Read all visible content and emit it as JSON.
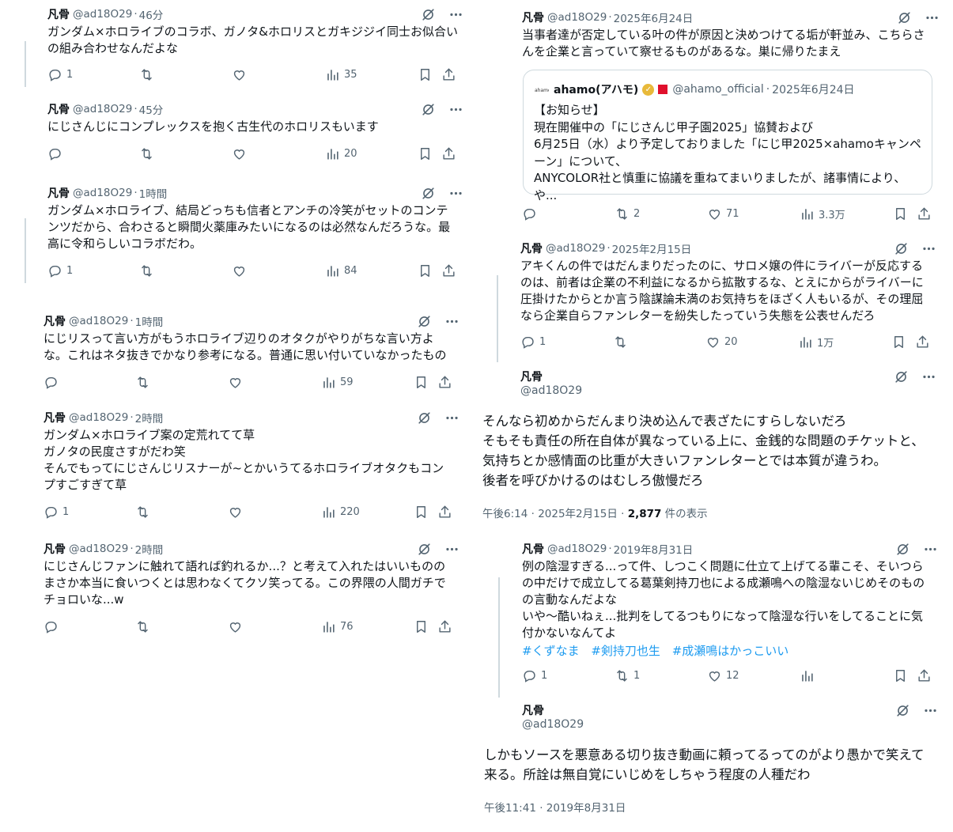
{
  "left_tweets": [
    {
      "name": "凡骨",
      "handle": "@ad18O29",
      "time": "46分",
      "text": "ガンダム×ホロライブのコラボ、ガノタ&ホロリスとガキジジイ同士お似合いの組み合わせなんだよな",
      "replies": "1",
      "retweets": "",
      "likes": "",
      "views": "35"
    },
    {
      "name": "凡骨",
      "handle": "@ad18O29",
      "time": "45分",
      "text": "にじさんじにコンプレックスを抱く古生代のホロリスもいます",
      "replies": "",
      "retweets": "",
      "likes": "",
      "views": "20"
    },
    {
      "name": "凡骨",
      "handle": "@ad18O29",
      "time": "1時間",
      "text": "ガンダム×ホロライブ、結局どっちも信者とアンチの冷笑がセットのコンテンツだから、合わさると瞬間火薬庫みたいになるのは必然なんだろうな。最高に令和らしいコラボだわ。",
      "replies": "1",
      "retweets": "",
      "likes": "",
      "views": "84"
    },
    {
      "name": "凡骨",
      "handle": "@ad18O29",
      "time": "1時間",
      "text": "にじリスって言い方がもうホロライブ辺りのオタクがやりがちな言い方よな。これはネタ抜きでかなり参考になる。普通に思い付いていなかったもの",
      "replies": "",
      "retweets": "",
      "likes": "",
      "views": "59"
    },
    {
      "name": "凡骨",
      "handle": "@ad18O29",
      "time": "2時間",
      "text": "ガンダム×ホロライブ案の定荒れてて草\nガノタの民度さすがだわ笑\nそんでもってにじさんじリスナーが~とかいうてるホロライブオタクもコンプすごすぎて草",
      "replies": "1",
      "retweets": "",
      "likes": "",
      "views": "220"
    },
    {
      "name": "凡骨",
      "handle": "@ad18O29",
      "time": "2時間",
      "text": "にじさんじファンに触れて語れば釣れるか...？と考えて入れたはいいもののまさか本当に食いつくとは思わなくてクソ笑ってる。この界隈の人間ガチでチョロいな...w",
      "replies": "",
      "retweets": "",
      "likes": "",
      "views": "76"
    }
  ],
  "right_tweet1": {
    "name": "凡骨",
    "handle": "@ad18O29",
    "time": "2025年6月24日",
    "text": "当事者達が否定している叶の件が原因と決めつけてる垢が軒並み、こちらさんを企業と言っていて察せるものがあるな。巣に帰りたまえ",
    "quote": {
      "logo": "ahamo",
      "name": "ahamo(アハモ)",
      "handle": "@ahamo_official",
      "time": "2025年6月24日",
      "text": "【お知らせ】\n現在開催中の「にじさんじ甲子園2025」協賛および\n6月25日（水）より予定しておりました「にじ甲2025×ahamoキャンペーン」について、\nANYCOLOR社と慎重に協議を重ねてまいりましたが、諸事情により、や..."
    },
    "replies": "",
    "retweets": "2",
    "likes": "71",
    "views": "3.3万"
  },
  "right_tweet2": {
    "name": "凡骨",
    "handle": "@ad18O29",
    "time": "2025年2月15日",
    "text": "アキくんの件ではだんまりだったのに、サロメ嬢の件にライバーが反応するのは、前者は企業の不利益になるから拡散するな、とえにからがライバーに圧掛けたからとか言う陰謀論未満のお気持ちをほざく人もいるが、その理屈なら企業自らファンレターを紛失したっていう失態を公表せんだろ",
    "replies": "1",
    "retweets": "",
    "likes": "20",
    "views": "1万"
  },
  "right_main1": {
    "name": "凡骨",
    "handle": "@ad18O29",
    "text": "そんなら初めからだんまり決め込んで表ざたにすらしないだろ\nそもそも責任の所在自体が異なっている上に、金銭的な問題のチケットと、気持ちとか感情面の比重が大きいファンレターとでは本質が違うわ。\n後者を呼びかけるのはむしろ傲慢だろ",
    "time": "午後6:14 · 2025年2月15日 · ",
    "views_num": "2,877",
    "views_label": " 件の表示"
  },
  "right_tweet3": {
    "name": "凡骨",
    "handle": "@ad18O29",
    "time": "2019年8月31日",
    "text": "例の陰湿すぎる...って件、しつこく問題に仕立て上げてる輩こそ、そいつらの中だけで成立してる葛葉剣持刀也による成瀬鳴への陰湿ないじめそのものの言動なんだよな\nいや〜酷いねぇ...批判をしてるつもりになって陰湿な行いをしてることに気付かないなんてよ",
    "hashtags": [
      "#くずなま",
      "#剣持刀也生",
      "#成瀬鳴はかっこいい"
    ],
    "replies": "1",
    "retweets": "1",
    "likes": "12",
    "views": ""
  },
  "right_main2": {
    "name": "凡骨",
    "handle": "@ad18O29",
    "text": "しかもソースを悪意ある切り抜き動画に頼ってるってのがより愚かで笑えて来る。所詮は無自覚にいじめをしちゃう程度の人種だわ",
    "time": "午後11:41 · 2019年8月31日"
  },
  "colors": {
    "text": "#0f1419",
    "muted": "#536471",
    "link": "#1d9bf0",
    "border": "#cfd9de"
  },
  "icons": [
    "reply-icon",
    "retweet-icon",
    "like-icon",
    "views-icon",
    "bookmark-icon",
    "share-icon",
    "grok-icon",
    "more-icon",
    "verified-badge-icon",
    "ahamo-logo-icon"
  ]
}
